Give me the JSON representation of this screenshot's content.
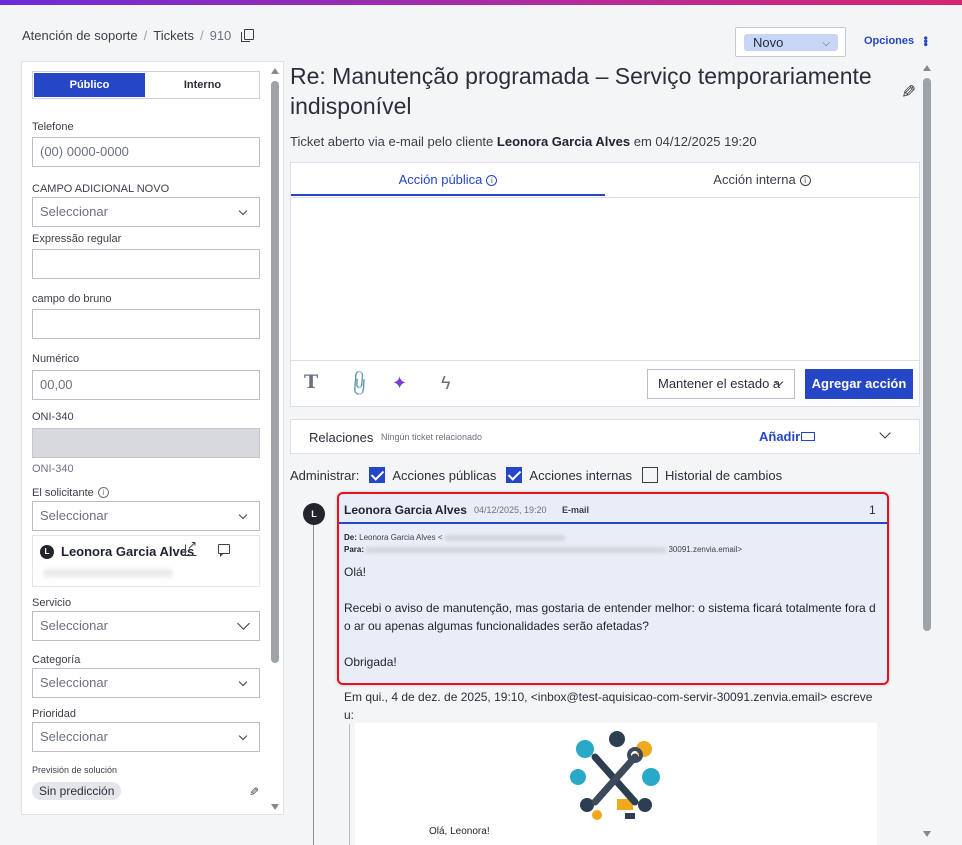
{
  "breadcrumb": {
    "root": "Atención de soporte",
    "section": "Tickets",
    "ticket_number": "910"
  },
  "status": {
    "value": "Novo",
    "options_label": "Opciones"
  },
  "left_panel": {
    "toggle": {
      "public": "Público",
      "internal": "Interno"
    },
    "fields": {
      "telefone": {
        "label": "Telefone",
        "placeholder": "(00) 0000-0000"
      },
      "campo_adicional": {
        "label": "CAMPO ADICIONAL NOVO",
        "value": "Seleccionar"
      },
      "expressao": {
        "label": "Expressão regular",
        "value": ""
      },
      "campo_bruno": {
        "label": "campo do bruno",
        "value": ""
      },
      "numerico": {
        "label": "Numérico",
        "placeholder": "00,00"
      },
      "oni_label": "ONI-340",
      "oni_footer": "ONI-340",
      "solicitante": {
        "label": "El solicitante",
        "value": "Seleccionar"
      },
      "servicio": {
        "label": "Servicio",
        "value": "Seleccionar"
      },
      "categoria": {
        "label": "Categoría",
        "value": "Seleccionar"
      },
      "prioridad": {
        "label": "Prioridad",
        "value": "Seleccionar"
      },
      "prevision": {
        "label": "Previsión de solución",
        "value": "Sin predicción"
      }
    },
    "requester": {
      "initial": "L",
      "name": "Leonora Garcia Alves"
    }
  },
  "ticket": {
    "title": "Re: Manutenção programada – Serviço temporariamente indisponível",
    "subtitle_prefix": "Ticket aberto via e-mail pelo cliente",
    "subtitle_client": "Leonora Garcia Alves",
    "subtitle_suffix": "em 04/12/2025 19:20"
  },
  "editor": {
    "tab_public": "Acción pública",
    "tab_internal": "Acción interna",
    "state_select": "Mantener el estado a",
    "add_button": "Agregar acción"
  },
  "relations": {
    "title": "Relaciones",
    "empty": "Ningún ticket relacionado",
    "add": "Añadir"
  },
  "admin": {
    "label": "Administrar:",
    "public_actions": "Acciones públicas",
    "internal_actions": "Acciones internas",
    "history": "Historial de cambios"
  },
  "message": {
    "initial": "L",
    "author": "Leonora Garcia Alves",
    "date": "04/12/2025, 19:20",
    "channel": "E-mail",
    "count": "1",
    "from_label": "De:",
    "from_name": "Leonora Garcia Alves <",
    "to_label": "Para:",
    "to_suffix": "30091.zenvia.email>",
    "body": [
      "Olá!",
      "Recebi o aviso de manutenção, mas gostaria de entender melhor: o sistema ficará totalmente fora d o ar ou apenas algumas funcionalidades serão afetadas?",
      "Obrigada!"
    ],
    "quote_header": "Em qui., 4 de dez. de 2025, 19:10, <inbox@test-aquisicao-com-servir-30091.zenvia.email> escreve u:",
    "quote_greeting": "Olá, Leonora!"
  }
}
